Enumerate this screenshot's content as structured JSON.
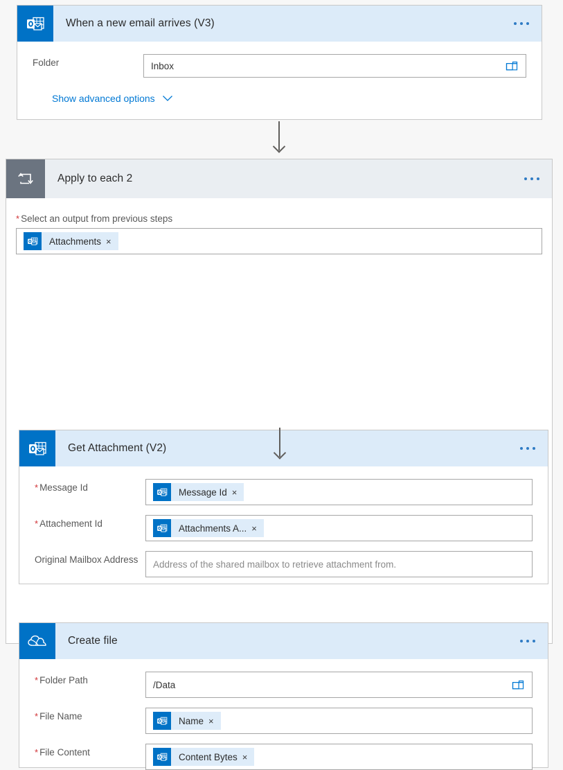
{
  "flow": {
    "trigger": {
      "title": "When a new email arrives (V3)",
      "icon": "outlook-icon",
      "menu_icon": "more-options-icon",
      "fields": [
        {
          "label": "Folder",
          "required": false,
          "value": "Inbox",
          "picker_icon": "folder-picker-icon"
        }
      ],
      "advanced_link": "Show advanced options",
      "advanced_chevron": "chevron-down-icon"
    },
    "loop": {
      "title": "Apply to each 2",
      "icon": "loop-icon",
      "menu_icon": "more-options-icon",
      "select_label": "Select an output from previous steps",
      "select_required": true,
      "token": {
        "text": "Attachments",
        "icon": "outlook-icon",
        "remove_icon": "remove-token-icon"
      }
    },
    "get_attachment": {
      "title": "Get Attachment (V2)",
      "icon": "outlook-icon",
      "menu_icon": "more-options-icon",
      "fields": [
        {
          "label": "Message Id",
          "required": true,
          "token": {
            "text": "Message Id",
            "icon": "outlook-icon",
            "remove_icon": "remove-token-icon"
          }
        },
        {
          "label": "Attachement Id",
          "required": true,
          "token": {
            "text": "Attachments A...",
            "icon": "outlook-icon",
            "remove_icon": "remove-token-icon"
          }
        },
        {
          "label": "Original Mailbox Address",
          "required": false,
          "placeholder": "Address of the shared mailbox to retrieve attachment from."
        }
      ]
    },
    "create_file": {
      "title": "Create file",
      "icon": "onedrive-icon",
      "menu_icon": "more-options-icon",
      "fields": [
        {
          "label": "Folder Path",
          "required": true,
          "value": "/Data",
          "picker_icon": "folder-picker-icon"
        },
        {
          "label": "File Name",
          "required": true,
          "token": {
            "text": "Name",
            "icon": "outlook-icon",
            "remove_icon": "remove-token-icon"
          }
        },
        {
          "label": "File Content",
          "required": true,
          "token": {
            "text": "Content Bytes",
            "icon": "outlook-icon",
            "remove_icon": "remove-token-icon"
          }
        }
      ]
    }
  },
  "colors": {
    "accent": "#0072c6",
    "header_bg": "#dcebf9",
    "loop_header_bg": "#eaeef2",
    "loop_icon_bg": "#6b7480",
    "required": "#d13438",
    "link": "#0078d4",
    "connector": "#605e5c",
    "chip_bg": "#deecf9",
    "page_bg": "#f7f7f7"
  }
}
